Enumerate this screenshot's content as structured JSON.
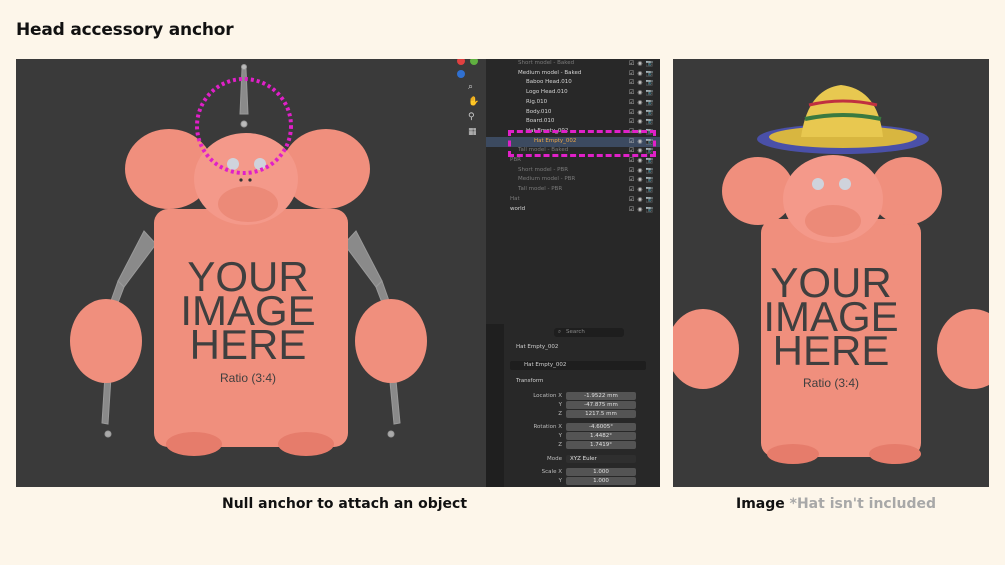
{
  "page": {
    "title": "Head accessory anchor",
    "caption_left": "Null anchor to attach an object",
    "caption_right_main": "Image",
    "caption_right_note": "*Hat isn't included"
  },
  "mockup": {
    "line1": "YOUR",
    "line2": "IMAGE",
    "line3": "HERE",
    "ratio": "Ratio (3:4)"
  },
  "colors": {
    "background": "#fdf6ea",
    "character": "#f08f7d",
    "highlight": "#e020c8",
    "viewport": "#3a3a3a",
    "panel": "#282828",
    "active_text": "#f0a848"
  },
  "outliner": {
    "rows": [
      {
        "label": "Short model - Baked",
        "dim": true
      },
      {
        "label": "Medium model - Baked",
        "dim": false
      },
      {
        "label": "Baboo Head.010",
        "dim": false
      },
      {
        "label": "Logo Head.010",
        "dim": false
      },
      {
        "label": "Rig.010",
        "dim": false
      },
      {
        "label": "Body.010",
        "dim": false
      },
      {
        "label": "Board.010",
        "dim": false
      },
      {
        "label": "Hat Empty_002",
        "dim": false
      },
      {
        "label": "Hat Empty_002",
        "dim": false,
        "active": true
      },
      {
        "label": "Tall model - Baked",
        "dim": true
      },
      {
        "label": "PBR",
        "dim": true
      },
      {
        "label": "Short model - PBR",
        "dim": true
      },
      {
        "label": "Medium model - PBR",
        "dim": true
      },
      {
        "label": "Tall model - PBR",
        "dim": true
      },
      {
        "label": "Hat",
        "dim": true
      },
      {
        "label": "world",
        "dim": false
      }
    ]
  },
  "properties": {
    "search_placeholder": "Search",
    "object_name": "Hat Empty_002",
    "object_data": "Hat Empty_002",
    "section": "Transform",
    "location_x_label": "Location X",
    "location_x": "-1.9522 mm",
    "location_y_label": "Y",
    "location_y": "-47.875 mm",
    "location_z_label": "Z",
    "location_z": "1217.5 mm",
    "rotation_x_label": "Rotation X",
    "rotation_x": "-4.6005°",
    "rotation_y_label": "Y",
    "rotation_y": "1.4482°",
    "rotation_z_label": "Z",
    "rotation_z": "1.7419°",
    "mode_label": "Mode",
    "mode": "XYZ Euler",
    "scale_x_label": "Scale X",
    "scale_x": "1.000",
    "scale_y_label": "Y",
    "scale_y": "1.000"
  }
}
